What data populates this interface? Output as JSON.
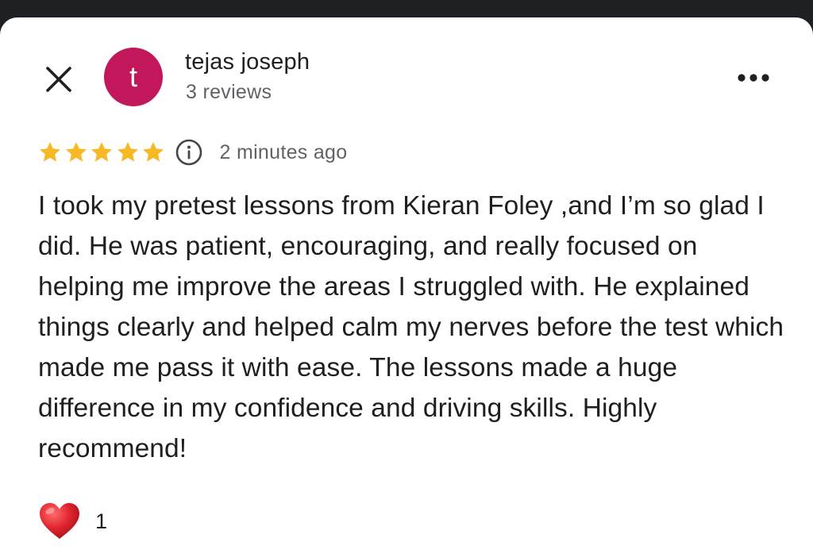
{
  "author": {
    "initial": "t",
    "name": "tejas joseph",
    "reviews": "3 reviews",
    "avatar_color": "#c2185b"
  },
  "review": {
    "rating": 5,
    "max_rating": 5,
    "star_color": "#f6b824",
    "time_ago": "2 minutes ago",
    "text": "I took my pretest lessons from Kieran Foley ,and I’m so glad I did. He was patient, encouraging, and really focused on helping me improve the areas I struggled with. He explained things clearly and helped calm my nerves before the test which made me pass it with ease. The lessons made a huge difference in my confidence and driving skills. Highly recommend!"
  },
  "reactions": {
    "icon": "heart-icon",
    "count": "1",
    "color": "#e0242e"
  },
  "icons": {
    "close": "close-icon",
    "more": "more-horizontal-icon",
    "info": "info-icon",
    "star": "star-icon"
  }
}
